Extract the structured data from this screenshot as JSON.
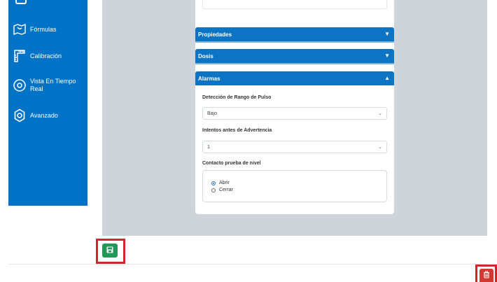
{
  "sidebar": {
    "items": [
      {
        "label": "Fórmulas",
        "icon": "formula-map-icon"
      },
      {
        "label": "Calibración",
        "icon": "ruler-icon"
      },
      {
        "label_line1": "Vista En Tiempo",
        "label_line2": "Real",
        "icon": "eye-icon"
      },
      {
        "label": "Avanzado",
        "icon": "gear-icon"
      }
    ]
  },
  "accordion": {
    "propiedades": {
      "label": "Propiedades",
      "caret": "▼"
    },
    "dosis": {
      "label": "Dosis",
      "caret": "▼"
    },
    "alarmas": {
      "label": "Alarmas",
      "caret": "▲"
    }
  },
  "alarmas": {
    "pulse_range_label": "Detección de Rango de Pulso",
    "pulse_range_value": "Bajo",
    "attempts_label": "Intentos antes de Advertencia",
    "attempts_value": "1",
    "level_contact_label": "Contacto prueba de nivel",
    "options": [
      {
        "label": "Abrir",
        "checked": true
      },
      {
        "label": "Cerrar",
        "checked": false
      }
    ]
  },
  "colors": {
    "sidebar": "#0073c6",
    "accordion_header": "#0b74c4",
    "save": "#1e9a56",
    "delete": "#d23a31",
    "highlight": "#d0262e"
  },
  "actions": {
    "save_icon": "floppy-disk-icon",
    "delete_icon": "trash-icon"
  }
}
